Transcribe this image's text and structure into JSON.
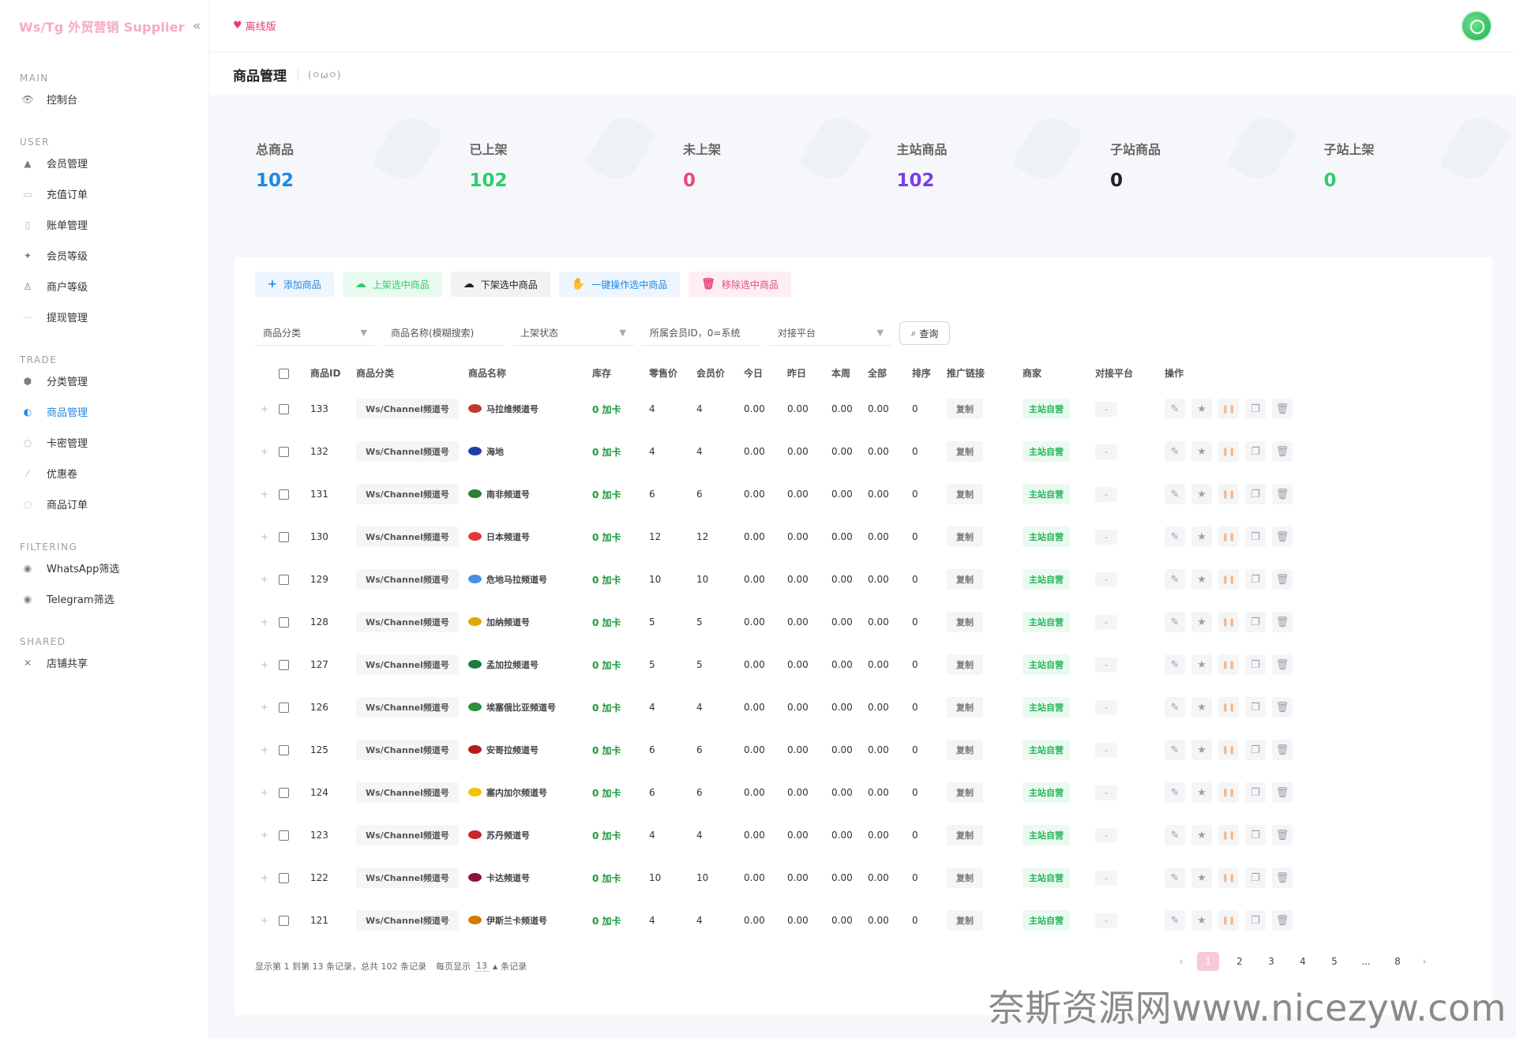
{
  "sidebar": {
    "brand": "Ws/Tg 外贸营销 Supplier",
    "sections": [
      {
        "title": "MAIN",
        "items": [
          {
            "label": "控制台",
            "icon": "eye-icon",
            "color": "#7a7f87"
          }
        ]
      },
      {
        "title": "USER",
        "items": [
          {
            "label": "会员管理",
            "icon": "user-icon",
            "color": "#7a7f87"
          },
          {
            "label": "充值订单",
            "icon": "card-icon",
            "color": "#b5b9bf"
          },
          {
            "label": "账单管理",
            "icon": "bill-icon",
            "color": "#b5b9bf"
          },
          {
            "label": "会员等级",
            "icon": "level-icon",
            "color": "#7a7f87"
          },
          {
            "label": "商户等级",
            "icon": "merchant-icon",
            "color": "#7a7f87"
          },
          {
            "label": "提现管理",
            "icon": "withdraw-icon",
            "color": "#b5b9bf"
          }
        ]
      },
      {
        "title": "TRADE",
        "items": [
          {
            "label": "分类管理",
            "icon": "category-icon",
            "color": "#7a7f87"
          },
          {
            "label": "商品管理",
            "icon": "product-icon",
            "color": "#1e88e5",
            "active": true
          },
          {
            "label": "卡密管理",
            "icon": "key-icon",
            "color": "#b5b9bf"
          },
          {
            "label": "优惠卷",
            "icon": "coupon-icon",
            "color": "#b5b9bf"
          },
          {
            "label": "商品订单",
            "icon": "order-icon",
            "color": "#c9ccd1"
          }
        ]
      },
      {
        "title": "FILTERING",
        "items": [
          {
            "label": "WhatsApp筛选",
            "icon": "filter-icon",
            "color": "#7a7f87"
          },
          {
            "label": "Telegram筛选",
            "icon": "filter-icon",
            "color": "#7a7f87"
          }
        ]
      },
      {
        "title": "SHARED",
        "items": [
          {
            "label": "店铺共享",
            "icon": "share-icon",
            "color": "#7a7f87"
          }
        ]
      }
    ]
  },
  "topbar": {
    "offline_label": "离线版"
  },
  "page": {
    "title": "商品管理",
    "emoticon": "(ㅇωㅇ)"
  },
  "stats": [
    {
      "label": "总商品",
      "value": "102",
      "color": "#1e88e5"
    },
    {
      "label": "已上架",
      "value": "102",
      "color": "#2ecc71"
    },
    {
      "label": "未上架",
      "value": "0",
      "color": "#e84a7a"
    },
    {
      "label": "主站商品",
      "value": "102",
      "color": "#7b3fe4"
    },
    {
      "label": "子站商品",
      "value": "0",
      "color": "#222222"
    },
    {
      "label": "子站上架",
      "value": "0",
      "color": "#2ecc71"
    }
  ],
  "toolbar": {
    "buttons": [
      {
        "label": "添加商品",
        "icon": "+",
        "bg": "#eef5fe",
        "fg": "#1e88e5"
      },
      {
        "label": "上架选中商品",
        "icon": "☁",
        "bg": "#eafaf0",
        "fg": "#2ecc71"
      },
      {
        "label": "下架选中商品",
        "icon": "☁",
        "bg": "#f1f2f4",
        "fg": "#222222"
      },
      {
        "label": "一键操作选中商品",
        "icon": "✋",
        "bg": "#eef5fe",
        "fg": "#1e88e5"
      },
      {
        "label": "移除选中商品",
        "icon": "🗑",
        "bg": "#fdeef3",
        "fg": "#e84a7a"
      }
    ]
  },
  "filters": {
    "category": "商品分类",
    "name": "商品名称(模糊搜索)",
    "status": "上架状态",
    "member": "所属会员ID，0=系统",
    "platform": "对接平台",
    "query_label": "查询"
  },
  "table": {
    "headers": [
      "商品ID",
      "商品分类",
      "商品名称",
      "库存",
      "零售价",
      "会员价",
      "今日",
      "昨日",
      "本周",
      "全部",
      "排序",
      "推广链接",
      "商家",
      "对接平台",
      "操作"
    ],
    "rows": [
      {
        "id": "133",
        "category": "Ws/Channel频道号",
        "name": "马拉维频道号",
        "flag": "#c0392b",
        "stock": "0 加卡",
        "retail": "4",
        "member": "4",
        "today": "0.00",
        "yesterday": "0.00",
        "week": "0.00",
        "all": "0.00",
        "sort": "0",
        "link": "复制",
        "merchant": "主站自营",
        "platform": "-"
      },
      {
        "id": "132",
        "category": "Ws/Channel频道号",
        "name": "海地",
        "flag": "#1f3fa8",
        "stock": "0 加卡",
        "retail": "4",
        "member": "4",
        "today": "0.00",
        "yesterday": "0.00",
        "week": "0.00",
        "all": "0.00",
        "sort": "0",
        "link": "复制",
        "merchant": "主站自营",
        "platform": "-"
      },
      {
        "id": "131",
        "category": "Ws/Channel频道号",
        "name": "南非频道号",
        "flag": "#2e7d32",
        "stock": "0 加卡",
        "retail": "6",
        "member": "6",
        "today": "0.00",
        "yesterday": "0.00",
        "week": "0.00",
        "all": "0.00",
        "sort": "0",
        "link": "复制",
        "merchant": "主站自营",
        "platform": "-"
      },
      {
        "id": "130",
        "category": "Ws/Channel频道号",
        "name": "日本频道号",
        "flag": "#e53935",
        "stock": "0 加卡",
        "retail": "12",
        "member": "12",
        "today": "0.00",
        "yesterday": "0.00",
        "week": "0.00",
        "all": "0.00",
        "sort": "0",
        "link": "复制",
        "merchant": "主站自营",
        "platform": "-"
      },
      {
        "id": "129",
        "category": "Ws/Channel频道号",
        "name": "危地马拉频道号",
        "flag": "#4a90e2",
        "stock": "0 加卡",
        "retail": "10",
        "member": "10",
        "today": "0.00",
        "yesterday": "0.00",
        "week": "0.00",
        "all": "0.00",
        "sort": "0",
        "link": "复制",
        "merchant": "主站自营",
        "platform": "-"
      },
      {
        "id": "128",
        "category": "Ws/Channel频道号",
        "name": "加纳频道号",
        "flag": "#e0a800",
        "stock": "0 加卡",
        "retail": "5",
        "member": "5",
        "today": "0.00",
        "yesterday": "0.00",
        "week": "0.00",
        "all": "0.00",
        "sort": "0",
        "link": "复制",
        "merchant": "主站自营",
        "platform": "-"
      },
      {
        "id": "127",
        "category": "Ws/Channel频道号",
        "name": "孟加拉频道号",
        "flag": "#1b7f3a",
        "stock": "0 加卡",
        "retail": "5",
        "member": "5",
        "today": "0.00",
        "yesterday": "0.00",
        "week": "0.00",
        "all": "0.00",
        "sort": "0",
        "link": "复制",
        "merchant": "主站自营",
        "platform": "-"
      },
      {
        "id": "126",
        "category": "Ws/Channel频道号",
        "name": "埃塞俄比亚频道号",
        "flag": "#2f8f3a",
        "stock": "0 加卡",
        "retail": "4",
        "member": "4",
        "today": "0.00",
        "yesterday": "0.00",
        "week": "0.00",
        "all": "0.00",
        "sort": "0",
        "link": "复制",
        "merchant": "主站自营",
        "platform": "-"
      },
      {
        "id": "125",
        "category": "Ws/Channel频道号",
        "name": "安哥拉频道号",
        "flag": "#b71c1c",
        "stock": "0 加卡",
        "retail": "6",
        "member": "6",
        "today": "0.00",
        "yesterday": "0.00",
        "week": "0.00",
        "all": "0.00",
        "sort": "0",
        "link": "复制",
        "merchant": "主站自营",
        "platform": "-"
      },
      {
        "id": "124",
        "category": "Ws/Channel频道号",
        "name": "塞内加尔频道号",
        "flag": "#f2c200",
        "stock": "0 加卡",
        "retail": "6",
        "member": "6",
        "today": "0.00",
        "yesterday": "0.00",
        "week": "0.00",
        "all": "0.00",
        "sort": "0",
        "link": "复制",
        "merchant": "主站自营",
        "platform": "-"
      },
      {
        "id": "123",
        "category": "Ws/Channel频道号",
        "name": "苏丹频道号",
        "flag": "#c62828",
        "stock": "0 加卡",
        "retail": "4",
        "member": "4",
        "today": "0.00",
        "yesterday": "0.00",
        "week": "0.00",
        "all": "0.00",
        "sort": "0",
        "link": "复制",
        "merchant": "主站自营",
        "platform": "-"
      },
      {
        "id": "122",
        "category": "Ws/Channel频道号",
        "name": "卡达频道号",
        "flag": "#8b1538",
        "stock": "0 加卡",
        "retail": "10",
        "member": "10",
        "today": "0.00",
        "yesterday": "0.00",
        "week": "0.00",
        "all": "0.00",
        "sort": "0",
        "link": "复制",
        "merchant": "主站自营",
        "platform": "-"
      },
      {
        "id": "121",
        "category": "Ws/Channel频道号",
        "name": "伊斯兰卡频道号",
        "flag": "#d97a00",
        "stock": "0 加卡",
        "retail": "4",
        "member": "4",
        "today": "0.00",
        "yesterday": "0.00",
        "week": "0.00",
        "all": "0.00",
        "sort": "0",
        "link": "复制",
        "merchant": "主站自营",
        "platform": "-"
      }
    ]
  },
  "footer": {
    "info": "显示第 1 到第 13 条记录，总共 102 条记录",
    "per_page_prefix": "每页显示",
    "per_page": "13",
    "per_page_suffix": "条记录",
    "pages": [
      "‹",
      "1",
      "2",
      "3",
      "4",
      "5",
      "...",
      "8",
      "›"
    ],
    "active_page": "1"
  },
  "watermark": "奈斯资源网www.nicezyw.com"
}
